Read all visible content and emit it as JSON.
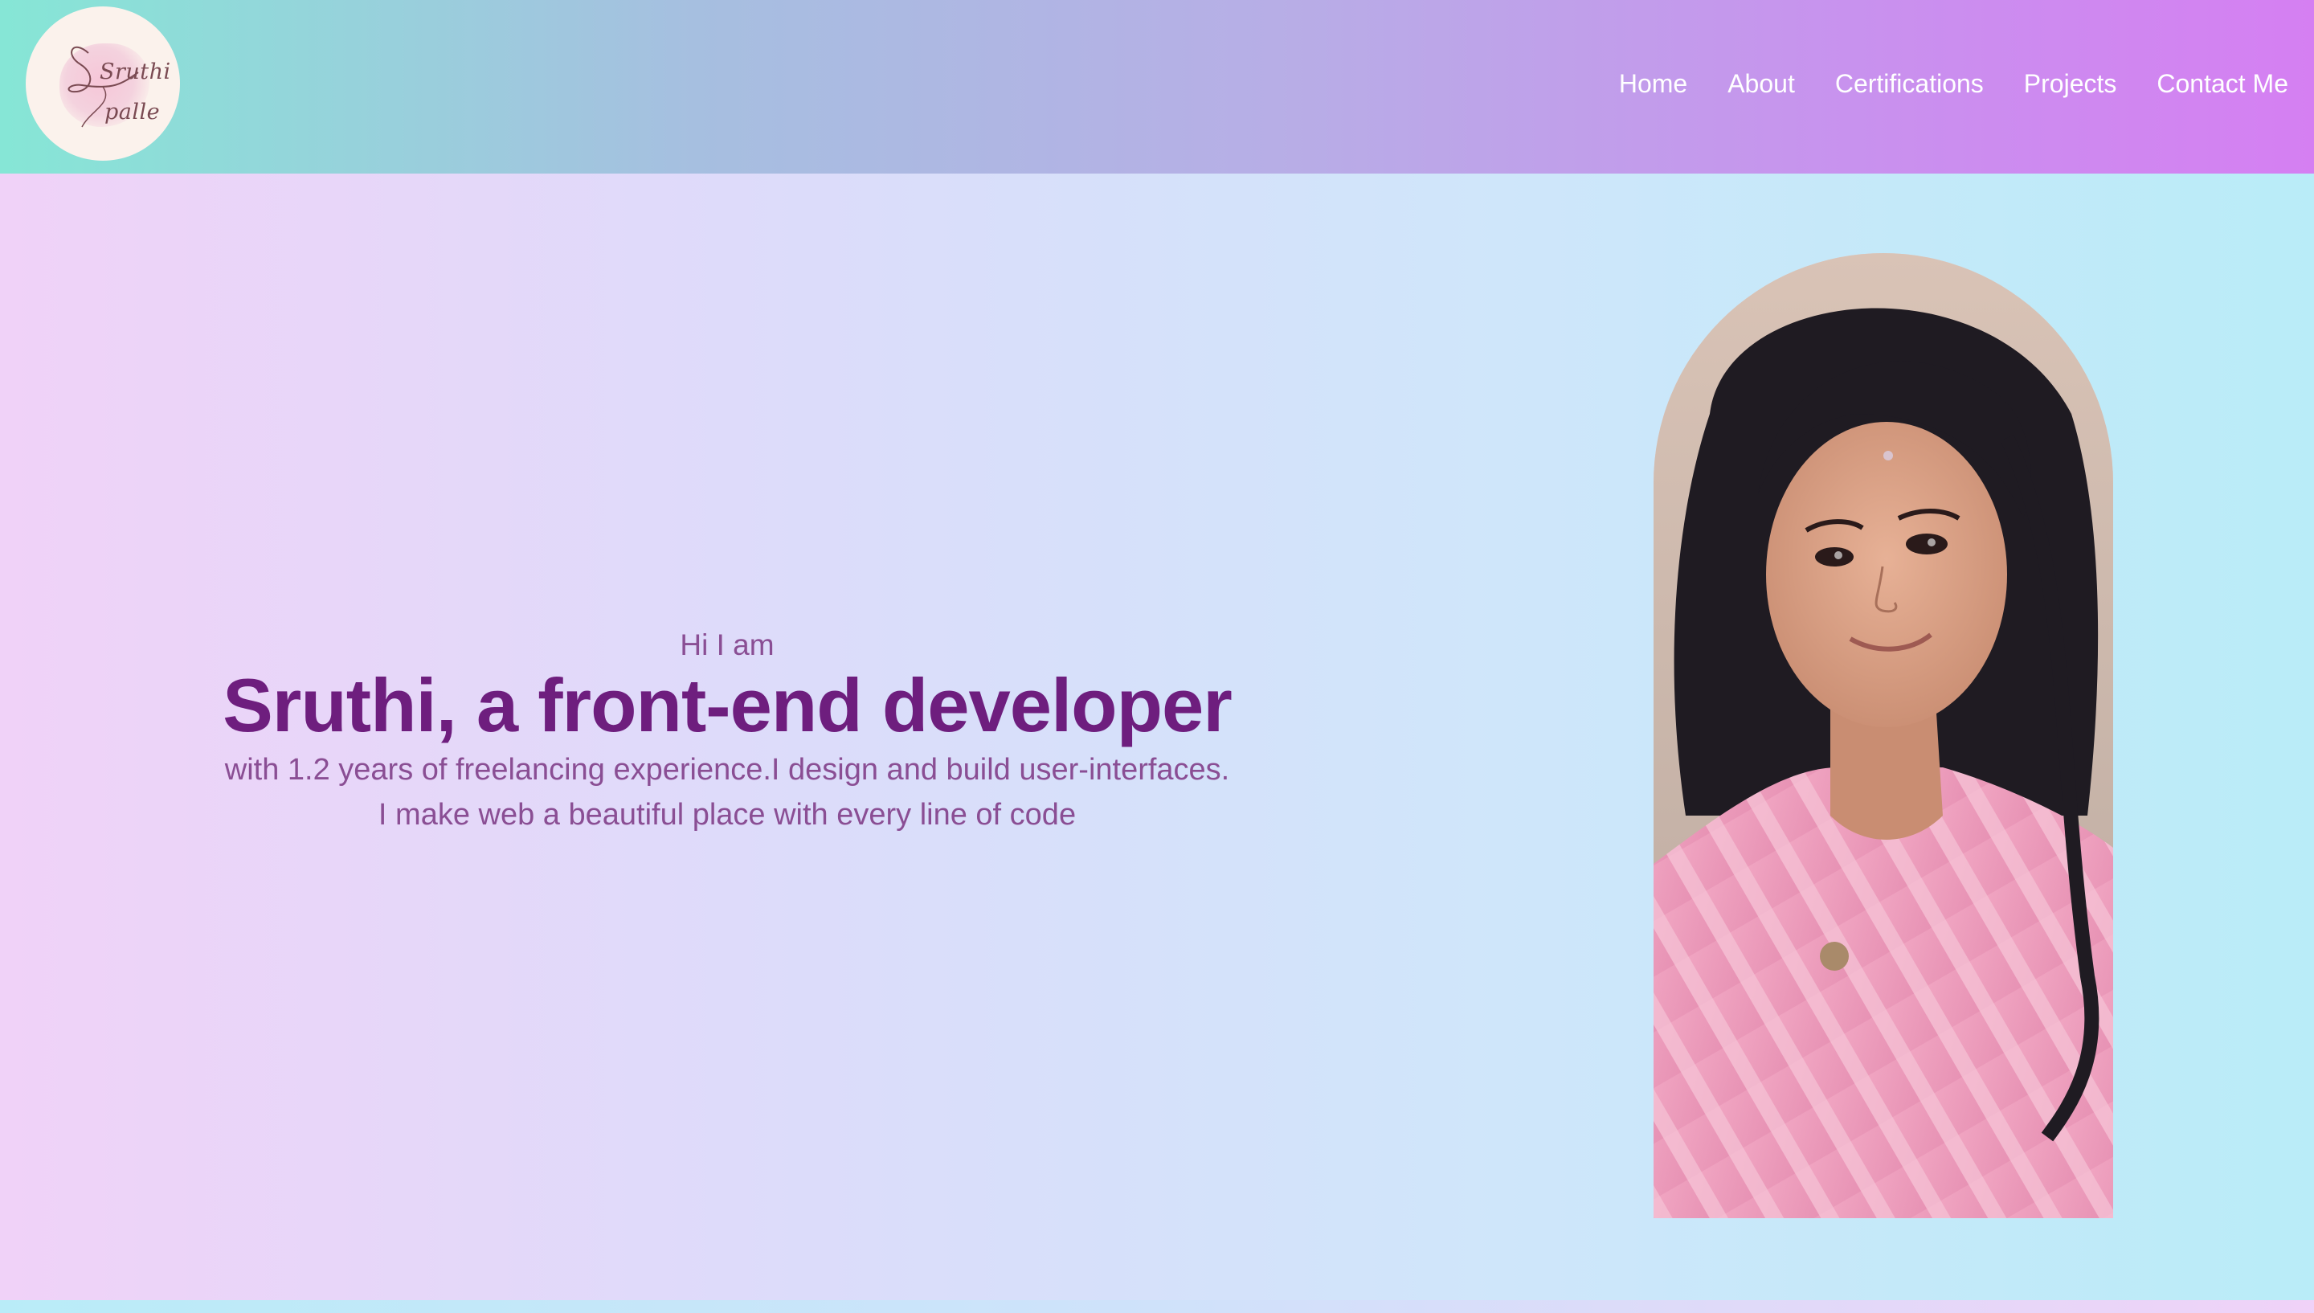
{
  "header": {
    "logo": {
      "line1": "Sruthi",
      "line2": "palle",
      "icon": "signature-logo"
    },
    "nav": [
      {
        "label": "Home"
      },
      {
        "label": "About"
      },
      {
        "label": "Certifications"
      },
      {
        "label": "Projects"
      },
      {
        "label": "Contact Me"
      }
    ]
  },
  "hero": {
    "intro": "Hi I am",
    "title": "Sruthi, a front-end developer",
    "desc_line1": "with 1.2 years of freelancing experience.I design and build user-interfaces.",
    "desc_line2": "I make web a beautiful place with every line of code"
  },
  "portrait": {
    "icon": "profile-photo"
  },
  "colors": {
    "header_start": "#86e6d6",
    "header_end": "#d57ff2",
    "title": "#6e1e7e",
    "text": "#8a4e94",
    "nav_text": "#ffffff"
  }
}
